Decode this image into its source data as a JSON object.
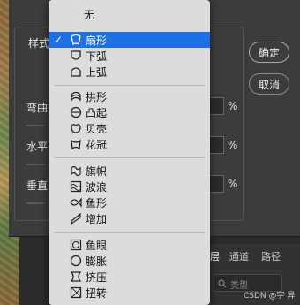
{
  "dialog": {
    "style_label": "样式",
    "bend_label": "弯曲",
    "h_label": "水平",
    "v_label": "垂直",
    "percent": "%",
    "ok_label": "确定",
    "cancel_label": "取消"
  },
  "menu": {
    "none_label": "无",
    "selected_check": "✓",
    "groups": [
      [
        {
          "label": "扇形",
          "icon": "arc-icon"
        },
        {
          "label": "下弧",
          "icon": "arc-lower-icon"
        },
        {
          "label": "上弧",
          "icon": "arc-upper-icon"
        }
      ],
      [
        {
          "label": "拱形",
          "icon": "arch-icon"
        },
        {
          "label": "凸起",
          "icon": "bulge-icon"
        },
        {
          "label": "贝壳",
          "icon": "shell-icon"
        },
        {
          "label": "花冠",
          "icon": "flag-crown-icon"
        }
      ],
      [
        {
          "label": "旗帜",
          "icon": "flag-icon"
        },
        {
          "label": "波浪",
          "icon": "wave-icon"
        },
        {
          "label": "鱼形",
          "icon": "fish-icon"
        },
        {
          "label": "增加",
          "icon": "rise-icon"
        }
      ],
      [
        {
          "label": "鱼眼",
          "icon": "fisheye-icon"
        },
        {
          "label": "膨胀",
          "icon": "inflate-icon"
        },
        {
          "label": "挤压",
          "icon": "squeeze-icon"
        },
        {
          "label": "扭转",
          "icon": "twist-icon"
        }
      ]
    ]
  },
  "layers_panel": {
    "tab_layers": "层",
    "tab_channels": "通道",
    "tab_paths": "路径",
    "type_placeholder": "类型"
  },
  "watermark": "CSDN @字 异"
}
